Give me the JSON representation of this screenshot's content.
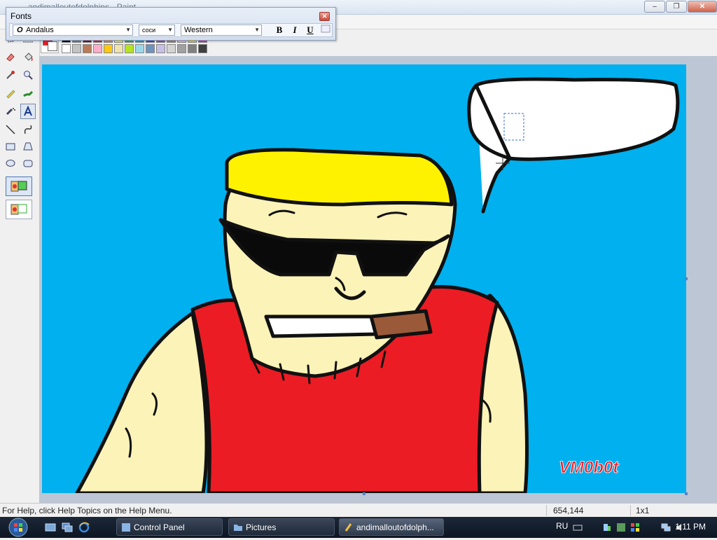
{
  "window": {
    "title": "andimalloutofdolphins - Paint",
    "minimize_label": "–",
    "maximize_label": "❐",
    "close_label": "✕"
  },
  "fonts_toolbar": {
    "title": "Fonts",
    "close_label": "✕",
    "font_name": "Andalus",
    "font_icon": "O",
    "font_size": "соси",
    "script": "Western",
    "bold_label": "B",
    "italic_label": "I",
    "underline_label": "U"
  },
  "palette": {
    "foreground": "#ec1c24",
    "background": "#ffffff",
    "colors_row1": [
      "#000000",
      "#7f7f7f",
      "#880015",
      "#ed1c24",
      "#ff7f27",
      "#fff200",
      "#22b14c",
      "#00a2e8",
      "#3f48cc",
      "#a349a4",
      "#b97a57",
      "#ffaec9",
      "#ffc90e",
      "#ef2fa4"
    ],
    "colors_row2": [
      "#ffffff",
      "#c3c3c3",
      "#b97a57",
      "#ffaec9",
      "#ffc90e",
      "#efe4b0",
      "#b5e61d",
      "#99d9ea",
      "#7092be",
      "#c8bfe7",
      "#d4d4d4",
      "#a0a0a0",
      "#808080",
      "#404040"
    ]
  },
  "tools": [
    "free-select",
    "select",
    "eraser",
    "fill",
    "color-picker",
    "magnifier",
    "pencil",
    "brush",
    "airbrush",
    "text",
    "line",
    "curve",
    "rectangle",
    "polygon",
    "ellipse",
    "rounded-rectangle"
  ],
  "active_tool": "text",
  "canvas": {
    "signature": "VM0b0t",
    "sky_color": "#00b0ef"
  },
  "status": {
    "help_text": "For Help, click Help Topics on the Help Menu.",
    "coordinates": "654,144",
    "size": "1x1"
  },
  "taskbar": {
    "buttons": [
      {
        "label": "Control Panel"
      },
      {
        "label": "Pictures"
      },
      {
        "label": "andimalloutofdolph..."
      }
    ],
    "language": "RU",
    "clock": "1:11 PM"
  }
}
